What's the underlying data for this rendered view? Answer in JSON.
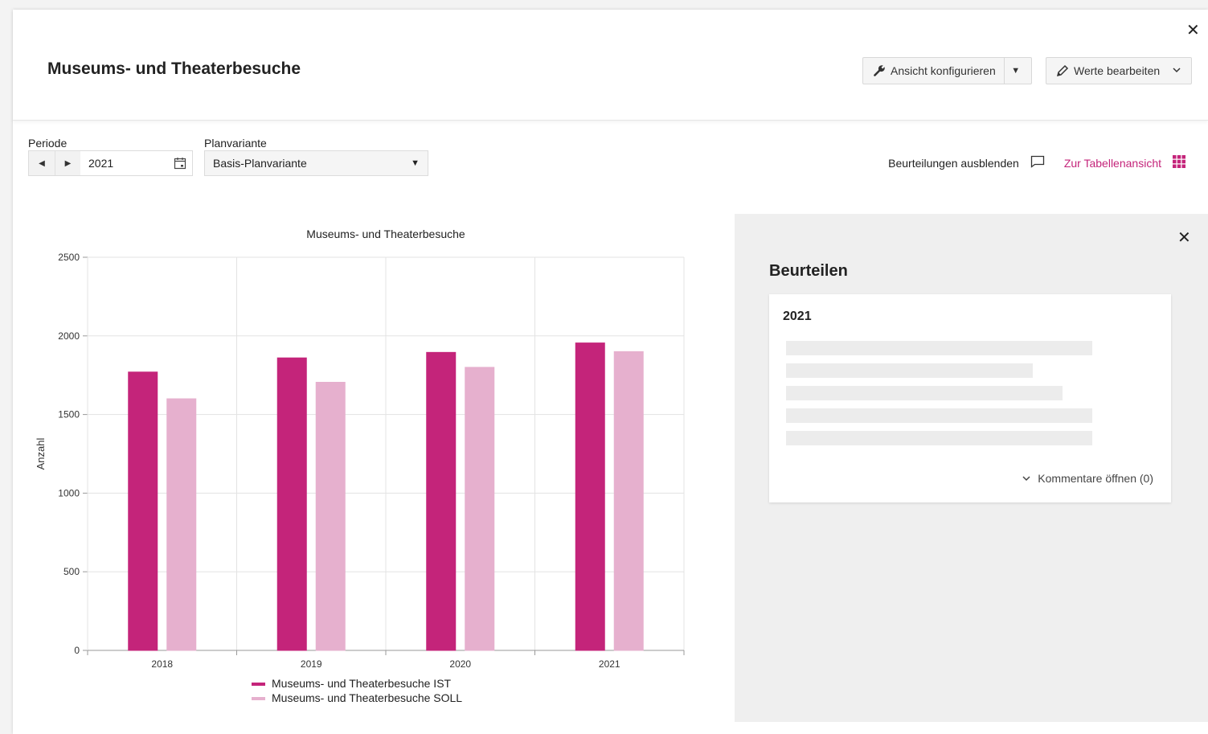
{
  "header": {
    "title": "Museums- und Theaterbesuche",
    "config_button": "Ansicht konfigurieren",
    "edit_button": "Werte bearbeiten"
  },
  "filters": {
    "period_label": "Periode",
    "period_value": "2021",
    "plan_label": "Planvariante",
    "plan_value": "Basis-Planvariante"
  },
  "links": {
    "hide_reviews": "Beurteilungen ausblenden",
    "table_view": "Zur Tabellenansicht"
  },
  "colors": {
    "accent": "#c4247a",
    "ist": "#c4247a",
    "soll": "#e6b0ce"
  },
  "chart_data": {
    "type": "bar",
    "title": "Museums- und Theaterbesuche",
    "xlabel": "",
    "ylabel": "Anzahl",
    "ylim": [
      0,
      2500
    ],
    "yticks": [
      0,
      500,
      1000,
      1500,
      2000,
      2500
    ],
    "grid": true,
    "legend_position": "bottom",
    "categories": [
      "2018",
      "2019",
      "2020",
      "2021"
    ],
    "series": [
      {
        "name": "Museums- und Theaterbesuche IST",
        "values": [
          1770,
          1860,
          1895,
          1955
        ]
      },
      {
        "name": "Museums- und Theaterbesuche SOLL",
        "values": [
          1600,
          1705,
          1800,
          1900
        ]
      }
    ]
  },
  "review_panel": {
    "title": "Beurteilen",
    "card_year": "2021",
    "comments_link": "Kommentare öffnen (0)"
  }
}
